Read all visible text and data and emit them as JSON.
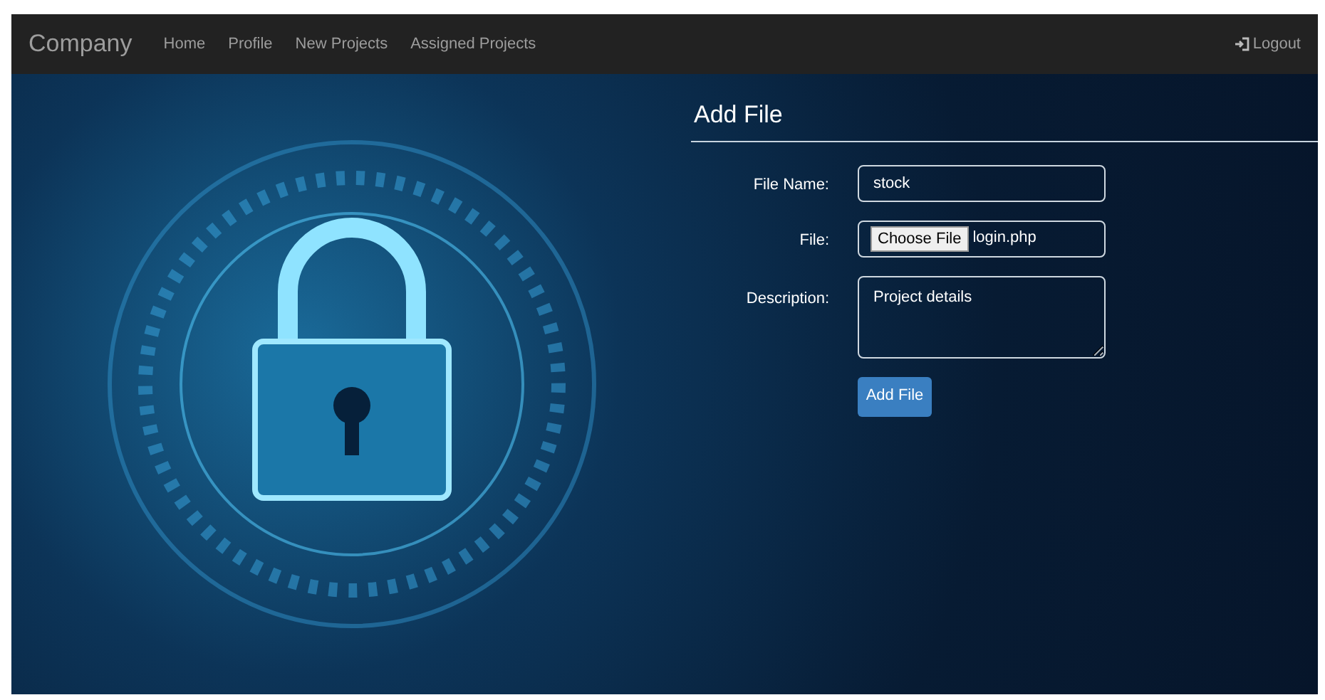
{
  "navbar": {
    "brand": "Company",
    "links": [
      {
        "label": "Home"
      },
      {
        "label": "Profile"
      },
      {
        "label": "New Projects"
      },
      {
        "label": "Assigned Projects"
      }
    ],
    "logout": "Logout"
  },
  "form": {
    "title": "Add File",
    "file_name": {
      "label": "File Name:",
      "value": "stock"
    },
    "file": {
      "label": "File:",
      "button": "Choose File",
      "filename": "login.php"
    },
    "description": {
      "label": "Description:",
      "value": "Project details"
    },
    "submit": "Add File"
  }
}
